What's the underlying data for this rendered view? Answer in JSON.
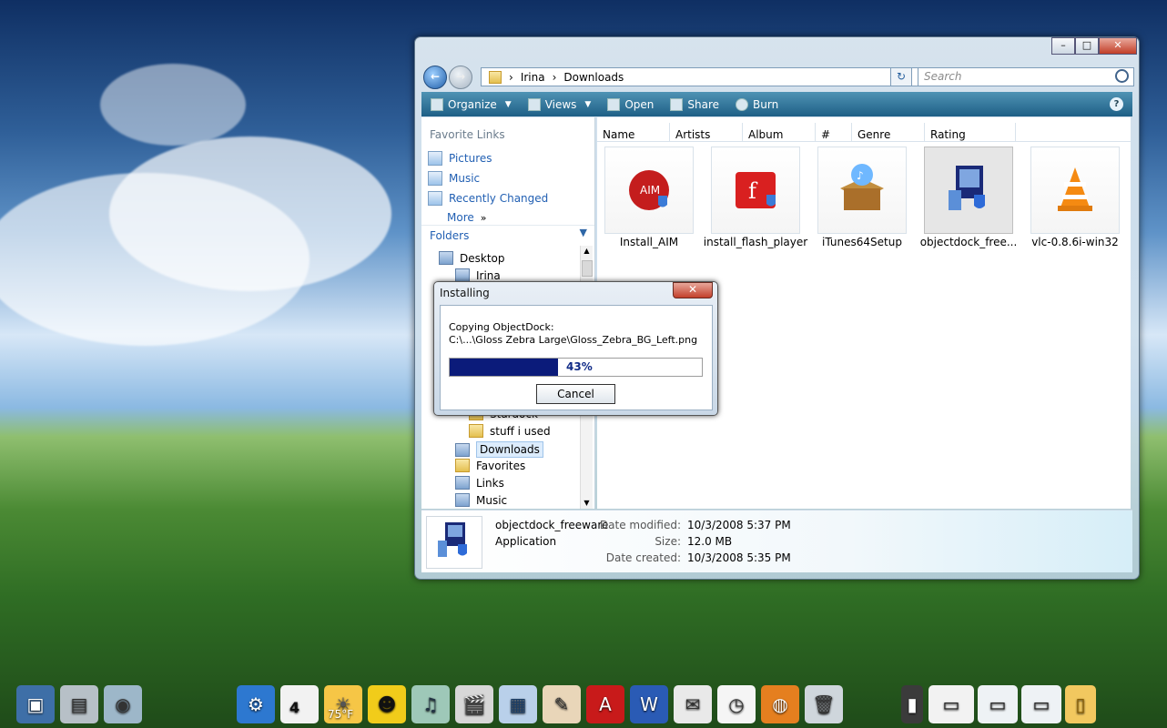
{
  "window": {
    "breadcrumb": [
      "Irina",
      "Downloads"
    ],
    "search_placeholder": "Search",
    "toolbar": {
      "organize": "Organize",
      "views": "Views",
      "open": "Open",
      "share": "Share",
      "burn": "Burn"
    },
    "left_pane": {
      "favorite_links_title": "Favorite Links",
      "favorites": [
        "Pictures",
        "Music",
        "Recently Changed",
        "More"
      ],
      "folders_title": "Folders",
      "tree": [
        "Desktop",
        "Irina",
        "Stardock",
        "stuff i used",
        "Downloads",
        "Favorites",
        "Links",
        "Music"
      ]
    },
    "columns": [
      "Name",
      "Artists",
      "Album",
      "#",
      "Genre",
      "Rating"
    ],
    "files": [
      {
        "name": "Install_AIM",
        "icon": "aim-icon"
      },
      {
        "name": "install_flash_player",
        "icon": "flash-icon"
      },
      {
        "name": "iTunes64Setup",
        "icon": "itunes-icon"
      },
      {
        "name": "objectdock_free...",
        "icon": "objectdock-icon"
      },
      {
        "name": "vlc-0.8.6i-win32",
        "icon": "vlc-icon"
      }
    ],
    "details": {
      "name": "objectdock_freeware",
      "type": "Application",
      "labels": {
        "modified": "Date modified:",
        "size": "Size:",
        "created": "Date created:"
      },
      "values": {
        "modified": "10/3/2008 5:37 PM",
        "size": "12.0 MB",
        "created": "10/3/2008 5:35 PM"
      }
    }
  },
  "dialog": {
    "title": "Installing",
    "line1": "Copying ObjectDock:",
    "line2": "C:\\...\\Gloss Zebra Large\\Gloss_Zebra_BG_Left.png",
    "progress_value": 0.43,
    "progress_text": "43%",
    "cancel_label": "Cancel"
  },
  "dock": {
    "temperature": "75°F",
    "calendar_day": "4"
  }
}
